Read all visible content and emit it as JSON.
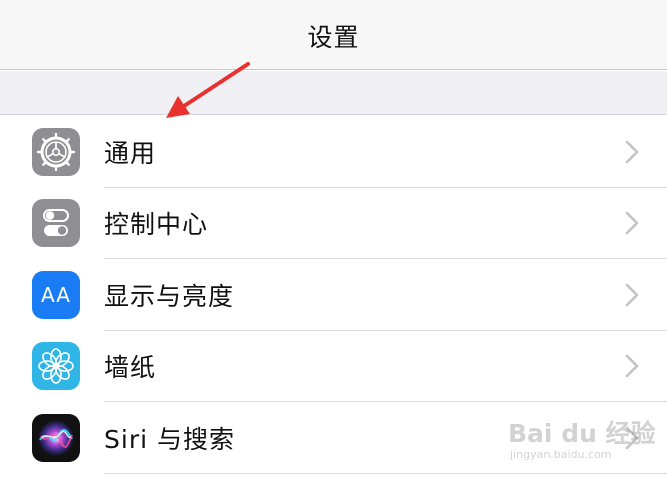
{
  "nav": {
    "title": "设置"
  },
  "rows": [
    {
      "label": "通用",
      "icon": "gear-icon",
      "color": "#8e8e93"
    },
    {
      "label": "控制中心",
      "icon": "toggles-icon",
      "color": "#8e8e93"
    },
    {
      "label": "显示与亮度",
      "icon": "text-size-icon",
      "color": "#1a7cf5",
      "glyph": "AA"
    },
    {
      "label": "墙纸",
      "icon": "flower-icon",
      "color": "#2fb6e6"
    },
    {
      "label": "Siri 与搜索",
      "icon": "siri-icon",
      "color": "#111111"
    }
  ],
  "colors": {
    "arrow": "#e8302f",
    "chevron": "#c4c4c8"
  },
  "watermark": {
    "main": "Bai du 经验",
    "sub": "jingyan.baidu.com"
  }
}
